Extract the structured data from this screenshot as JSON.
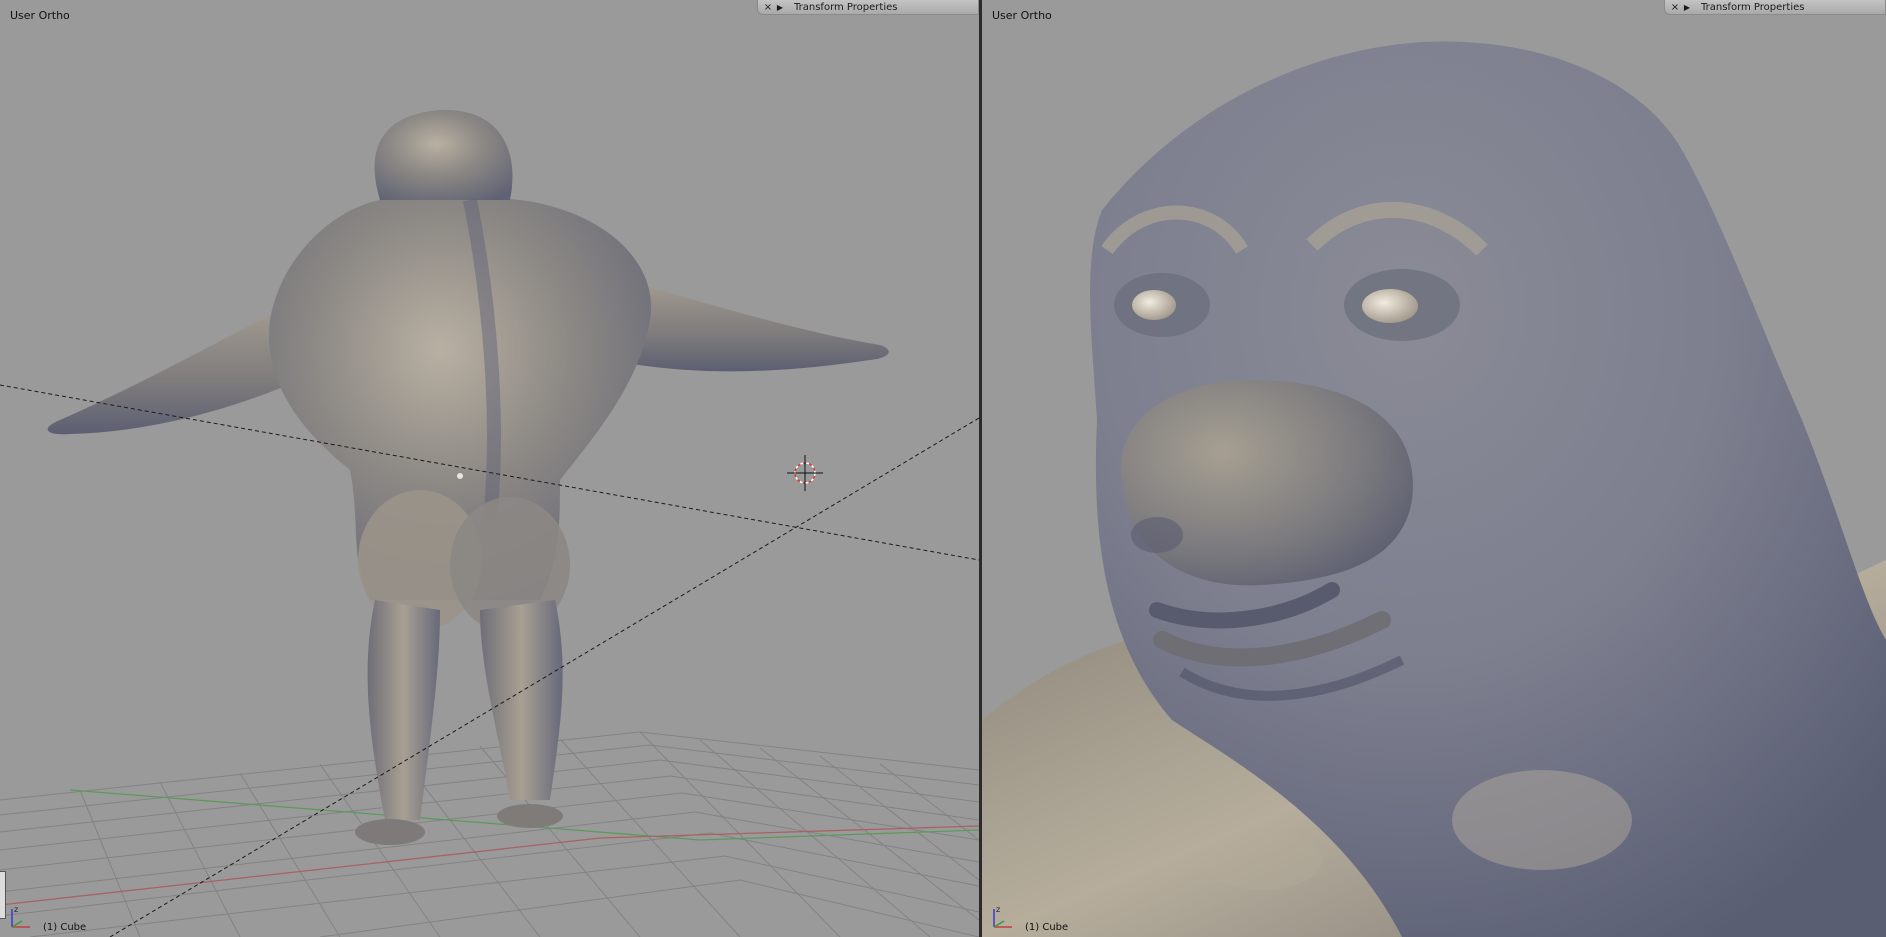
{
  "viewports": {
    "left": {
      "view_label": "User Ortho",
      "object_label": "(1) Cube",
      "panel": {
        "title": "Transform Properties"
      }
    },
    "right": {
      "view_label": "User Ortho",
      "object_label": "(1) Cube",
      "panel": {
        "title": "Transform Properties"
      }
    }
  },
  "icons": {
    "close": "×",
    "expand": "▶"
  },
  "colors": {
    "viewport_bg": "#9a9a9a",
    "grid": "#828282",
    "x_axis": "#a86262",
    "y_axis": "#5c9a5c",
    "mesh_base": "#8e8a86",
    "mesh_shadow": "#5d6075",
    "mesh_highlight": "#c8bfae"
  }
}
